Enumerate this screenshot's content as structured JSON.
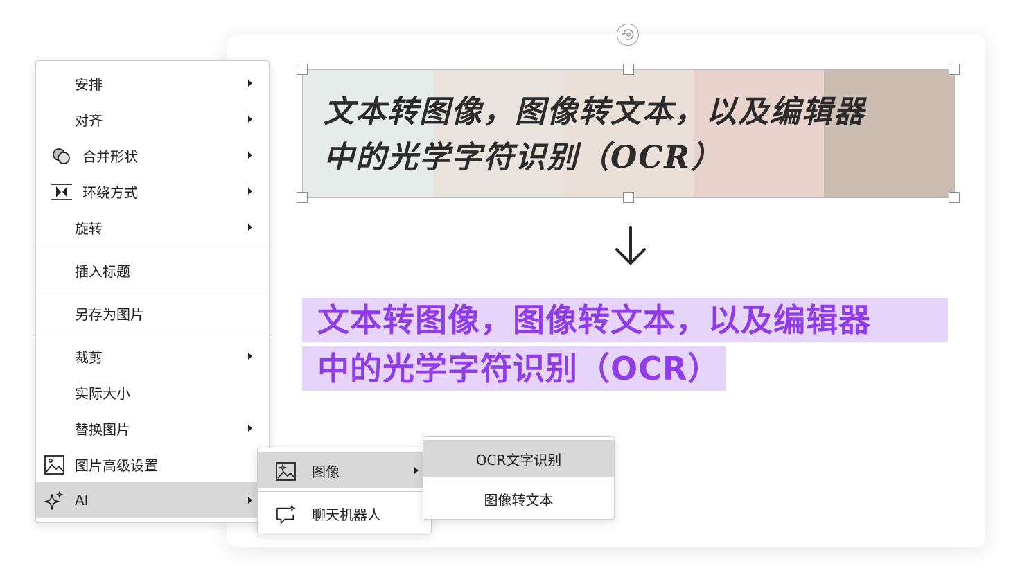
{
  "image": {
    "text_lines": [
      "文本转图像，图像转文本，以及编辑器",
      "中的光学字符识别（OCR）"
    ],
    "band_colors": [
      "#e6ecea",
      "#e9e3de",
      "#ebe0d8",
      "#e8d4cd",
      "#cbbdb1"
    ]
  },
  "ocr_result": {
    "lines": [
      "文本转图像，图像转文本，以及编辑器",
      "中的光学字符识别（OCR）"
    ],
    "text_color": "#8f3de8",
    "highlight_color": "#e7d4fb"
  },
  "context_menu": {
    "items": [
      {
        "label": "安排",
        "has_submenu": true
      },
      {
        "label": "对齐",
        "has_submenu": true
      },
      {
        "label": "合并形状",
        "icon": "merge-shapes-icon",
        "has_submenu": true
      },
      {
        "label": "环绕方式",
        "icon": "text-wrap-icon",
        "has_submenu": true
      },
      {
        "label": "旋转",
        "has_submenu": true
      },
      {
        "label": "插入标题"
      },
      {
        "label": "另存为图片"
      },
      {
        "label": "裁剪",
        "has_submenu": true
      },
      {
        "label": "实际大小"
      },
      {
        "label": "替换图片",
        "has_submenu": true
      },
      {
        "label": "图片高级设置",
        "icon": "picture-icon"
      },
      {
        "label": "AI",
        "icon": "sparkle-icon",
        "has_submenu": true,
        "active": true
      }
    ]
  },
  "ai_submenu": {
    "items": [
      {
        "label": "图像",
        "icon": "image-ai-icon",
        "has_submenu": true,
        "active": true
      },
      {
        "label": "聊天机器人",
        "icon": "chat-bot-icon"
      }
    ]
  },
  "image_submenu": {
    "items": [
      {
        "label": "OCR文字识别",
        "active": true
      },
      {
        "label": "图像转文本"
      }
    ]
  }
}
